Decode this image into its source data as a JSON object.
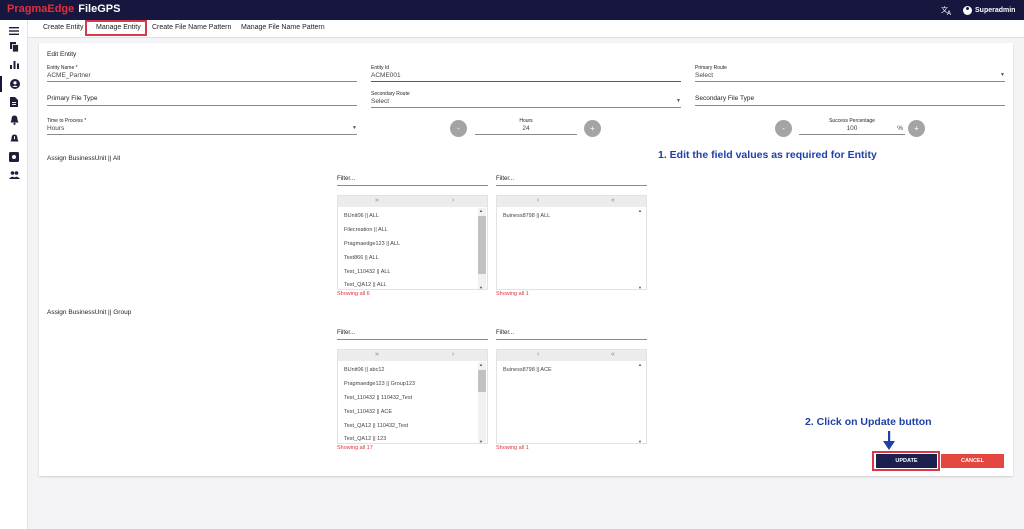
{
  "header": {
    "brand_primary": "PragmaEdge",
    "brand_secondary": "FileGPS",
    "user_name": "Superadmin",
    "translate_icon": "translate-icon"
  },
  "tabs": [
    {
      "label": "Create Entity"
    },
    {
      "label": "Manage Entity"
    },
    {
      "label": "Create File Name Pattern"
    },
    {
      "label": "Manage File Name Pattern"
    }
  ],
  "form": {
    "section_title": "Edit Entity",
    "entity_name": {
      "label": "Entity Name *",
      "value": "ACME_Partner"
    },
    "entity_id": {
      "label": "Entity Id",
      "value": "ACME001"
    },
    "primary_route": {
      "label": "Primary Route",
      "value": "Select"
    },
    "primary_file_type": {
      "label": "Primary File Type"
    },
    "secondary_route": {
      "label": "Secondary Route",
      "value": "Select"
    },
    "secondary_file_type": {
      "label": "Secondary File Type"
    },
    "time_to_process": {
      "label": "Time to Process *",
      "value": "Hours"
    },
    "hours": {
      "label": "Hours",
      "value": "24",
      "minus": "-",
      "plus": "+"
    },
    "success": {
      "label": "Success Percentage",
      "value": "100",
      "unit": "%",
      "minus": "-",
      "plus": "+"
    }
  },
  "assign_all": {
    "title": "Assign BusinessUnit || All",
    "left": {
      "filter": "Filter...",
      "arrows": [
        "»",
        "›"
      ],
      "items": [
        "BUnit06 || ALL",
        "Filecreation || ALL",
        "Pragmaedge123 || ALL",
        "Test866 || ALL",
        "Test_110432 || ALL",
        "Test_QA12 || ALL"
      ],
      "showing": "Showing all 6"
    },
    "right": {
      "filter": "Filter...",
      "arrows": [
        "‹",
        "«"
      ],
      "items": [
        "Buiness8798 || ALL"
      ],
      "showing": "Showing all 1"
    }
  },
  "assign_group": {
    "title": "Assign BusinessUnit || Group",
    "left": {
      "filter": "Filter...",
      "arrows": [
        "»",
        "›"
      ],
      "items": [
        "BUnit06 || abc12",
        "Pragmaedge123 || Group123",
        "Test_110432 || 110432_Test",
        "Test_110432 || ACE",
        "Test_QA12 || 110432_Test",
        "Test_QA12 || 123"
      ],
      "showing": "Showing all 17"
    },
    "right": {
      "filter": "Filter...",
      "arrows": [
        "‹",
        "«"
      ],
      "items": [
        "Buiness8798 || ACE"
      ],
      "showing": "Showing all 1"
    }
  },
  "annotations": {
    "step1": "1. Edit the field values as required for Entity",
    "step2": "2. Click on Update button"
  },
  "buttons": {
    "update": "UPDATE",
    "cancel": "CANCEL"
  },
  "colors": {
    "navy": "#16163f",
    "brand_red": "#e0303b",
    "highlight": "#d63a4a",
    "annotation_blue": "#2040a8",
    "cancel": "#e4473f"
  }
}
